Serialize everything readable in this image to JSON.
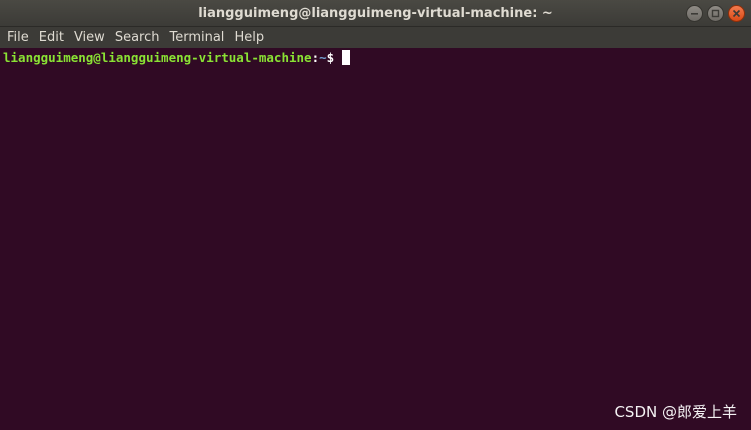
{
  "window": {
    "title": "liangguimeng@liangguimeng-virtual-machine: ~",
    "buttons": [
      "minimize-icon",
      "maximize-icon",
      "close-icon"
    ]
  },
  "menubar": {
    "items": [
      "File",
      "Edit",
      "View",
      "Search",
      "Terminal",
      "Help"
    ]
  },
  "terminal": {
    "prompt_user_host": "liangguimeng@liangguimeng-virtual-machine",
    "prompt_colon": ":",
    "prompt_path": "~",
    "prompt_symbol": "$ "
  },
  "watermark": "CSDN @郎爱上羊",
  "colors": {
    "background": "#300a24",
    "titlebar": "#3c3b37",
    "prompt_user": "#8ae234",
    "prompt_path": "#729fcf",
    "close_button": "#e95420"
  }
}
